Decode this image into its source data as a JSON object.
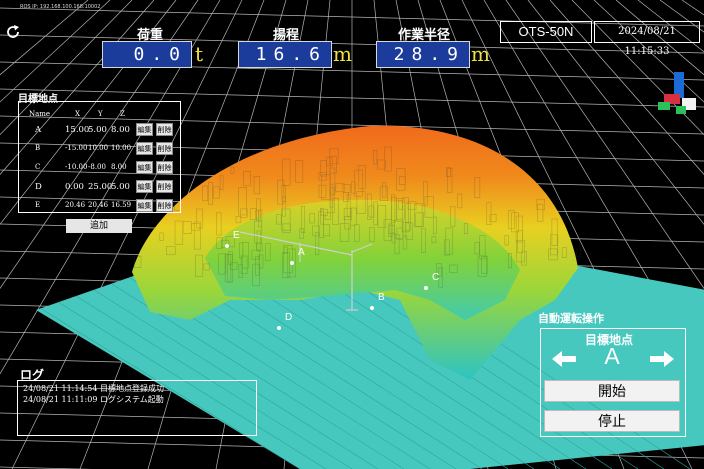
{
  "header": {
    "ros_ip": "ROS IP:     192.168.100.168:10002",
    "load_label": "荷重",
    "load_value": "0.0",
    "load_unit": "t",
    "lift_label": "揚程",
    "lift_value": "16.6",
    "lift_unit": "m",
    "radius_label": "作業半径",
    "radius_value": "28.9",
    "radius_unit": "m",
    "machine_id": "OTS-50N",
    "datetime": "2024/08/21 11:15:33"
  },
  "targets": {
    "title": "目標地点",
    "columns": [
      "Name",
      "X",
      "Y",
      "Z"
    ],
    "rows": [
      {
        "name": "A",
        "x": "15.00",
        "y": "5.00",
        "z": "8.00",
        "edit": "編集",
        "del": "削除"
      },
      {
        "name": "B",
        "x": "-15.00",
        "y": "10.00",
        "z": "10.00",
        "edit": "編集",
        "del": "削除"
      },
      {
        "name": "C",
        "x": "-10.00",
        "y": "-8.00",
        "z": "8.00",
        "edit": "編集",
        "del": "削除"
      },
      {
        "name": "D",
        "x": "0.00",
        "y": "25.00",
        "z": "5.00",
        "edit": "編集",
        "del": "削除"
      },
      {
        "name": "E",
        "x": "20.46",
        "y": "20.46",
        "z": "16.59",
        "edit": "編集",
        "del": "削除"
      }
    ],
    "add_label": "追加"
  },
  "scene": {
    "markers": [
      "A",
      "B",
      "C",
      "D",
      "E"
    ]
  },
  "log": {
    "title": "ログ",
    "entries": [
      "24/08/21 11:14:54  目標地点登録成功",
      "24/08/21 11:11:09  ログシステム起動"
    ]
  },
  "control": {
    "title": "自動運転操作",
    "subtitle": "目標地点",
    "selected": "A",
    "start_label": "開始",
    "stop_label": "停止"
  },
  "colors": {
    "ground": "#46c8be",
    "grid": "#bdbdbd",
    "value_box": "#1c3c9c",
    "unit": "#f0e040"
  }
}
